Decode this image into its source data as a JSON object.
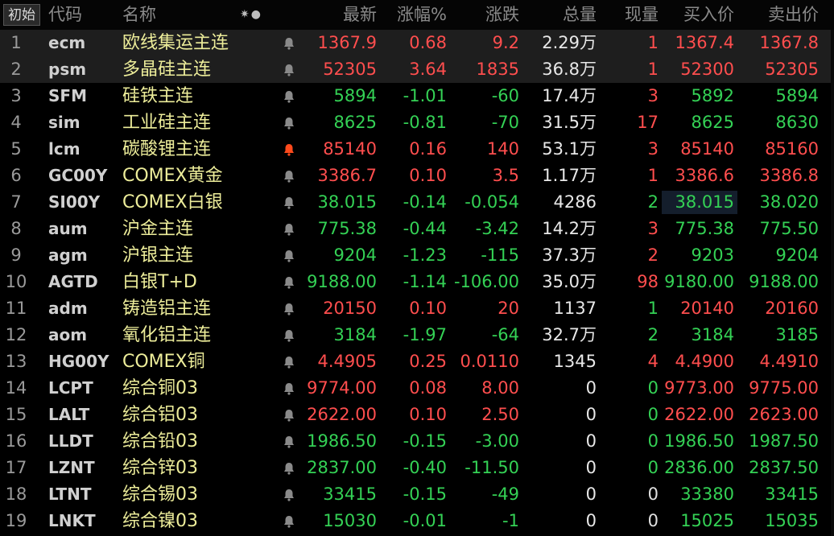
{
  "header": {
    "init_label": "初始",
    "columns": {
      "code": "代码",
      "name": "名称",
      "icons": "✷●",
      "last": "最新",
      "pct": "涨幅%",
      "chg": "涨跌",
      "vol": "总量",
      "cur": "现量",
      "bid": "买入价",
      "ask": "卖出价"
    }
  },
  "colors": {
    "up": "#ff4e4e",
    "down": "#34d155",
    "name": "#eded9a",
    "bell_active": "#ff4a1c",
    "bell_inactive": "#8a8a8a"
  },
  "rows": [
    {
      "idx": "1",
      "code": "ecm",
      "name": "欧线集运主连",
      "last": "1367.9",
      "pct": "0.68",
      "chg": "9.2",
      "vol": "2.29",
      "wan": "万",
      "cur": "1",
      "bid": "1367.4",
      "ask": "1367.8",
      "dir": "up",
      "cur_dir": "up",
      "sel": true,
      "bell_active": false
    },
    {
      "idx": "2",
      "code": "psm",
      "name": "多晶硅主连",
      "last": "52305",
      "pct": "3.64",
      "chg": "1835",
      "vol": "36.8",
      "wan": "万",
      "cur": "1",
      "bid": "52300",
      "ask": "52305",
      "dir": "up",
      "cur_dir": "up",
      "sel": true,
      "bell_active": false
    },
    {
      "idx": "3",
      "code": "SFM",
      "name": "硅铁主连",
      "last": "5894",
      "pct": "-1.01",
      "chg": "-60",
      "vol": "17.4",
      "wan": "万",
      "cur": "3",
      "bid": "5892",
      "ask": "5894",
      "dir": "down",
      "cur_dir": "up",
      "sel": false,
      "bell_active": false
    },
    {
      "idx": "4",
      "code": "sim",
      "name": "工业硅主连",
      "last": "8625",
      "pct": "-0.81",
      "chg": "-70",
      "vol": "31.5",
      "wan": "万",
      "cur": "17",
      "bid": "8625",
      "ask": "8630",
      "dir": "down",
      "cur_dir": "up",
      "sel": false,
      "bell_active": false
    },
    {
      "idx": "5",
      "code": "lcm",
      "name": "碳酸锂主连",
      "last": "85140",
      "pct": "0.16",
      "chg": "140",
      "vol": "53.1",
      "wan": "万",
      "cur": "3",
      "bid": "85140",
      "ask": "85160",
      "dir": "up",
      "cur_dir": "up",
      "sel": false,
      "bell_active": true
    },
    {
      "idx": "6",
      "code": "GC00Y",
      "name": "COMEX黄金",
      "last": "3386.7",
      "pct": "0.10",
      "chg": "3.5",
      "vol": "1.17",
      "wan": "万",
      "cur": "1",
      "bid": "3386.6",
      "ask": "3386.8",
      "dir": "up",
      "cur_dir": "up",
      "sel": false,
      "bell_active": false
    },
    {
      "idx": "7",
      "code": "SI00Y",
      "name": "COMEX白银",
      "last": "38.015",
      "pct": "-0.14",
      "chg": "-0.054",
      "vol": "4286",
      "wan": "",
      "cur": "2",
      "bid": "38.015",
      "ask": "38.020",
      "dir": "down",
      "cur_dir": "down",
      "sel": false,
      "bell_active": false,
      "hl_bid": true
    },
    {
      "idx": "8",
      "code": "aum",
      "name": "沪金主连",
      "last": "775.38",
      "pct": "-0.44",
      "chg": "-3.42",
      "vol": "14.2",
      "wan": "万",
      "cur": "3",
      "bid": "775.38",
      "ask": "775.50",
      "dir": "down",
      "cur_dir": "up",
      "sel": false,
      "bell_active": false
    },
    {
      "idx": "9",
      "code": "agm",
      "name": "沪银主连",
      "last": "9204",
      "pct": "-1.23",
      "chg": "-115",
      "vol": "37.3",
      "wan": "万",
      "cur": "2",
      "bid": "9203",
      "ask": "9204",
      "dir": "down",
      "cur_dir": "up",
      "sel": false,
      "bell_active": false
    },
    {
      "idx": "10",
      "code": "AGTD",
      "name": "白银T+D",
      "last": "9188.00",
      "pct": "-1.14",
      "chg": "-106.00",
      "vol": "35.0",
      "wan": "万",
      "cur": "98",
      "bid": "9180.00",
      "ask": "9188.00",
      "dir": "down",
      "cur_dir": "up",
      "sel": false,
      "bell_active": false
    },
    {
      "idx": "11",
      "code": "adm",
      "name": "铸造铝主连",
      "last": "20150",
      "pct": "0.10",
      "chg": "20",
      "vol": "1137",
      "wan": "",
      "cur": "1",
      "bid": "20140",
      "ask": "20160",
      "dir": "up",
      "cur_dir": "down",
      "sel": false,
      "bell_active": false
    },
    {
      "idx": "12",
      "code": "aom",
      "name": "氧化铝主连",
      "last": "3184",
      "pct": "-1.97",
      "chg": "-64",
      "vol": "32.7",
      "wan": "万",
      "cur": "2",
      "bid": "3184",
      "ask": "3185",
      "dir": "down",
      "cur_dir": "down",
      "sel": false,
      "bell_active": false
    },
    {
      "idx": "13",
      "code": "HG00Y",
      "name": "COMEX铜",
      "last": "4.4905",
      "pct": "0.25",
      "chg": "0.0110",
      "vol": "1345",
      "wan": "",
      "cur": "4",
      "bid": "4.4900",
      "ask": "4.4910",
      "dir": "up",
      "cur_dir": "up",
      "sel": false,
      "bell_active": false
    },
    {
      "idx": "14",
      "code": "LCPT",
      "name": "综合铜03",
      "last": "9774.00",
      "pct": "0.08",
      "chg": "8.00",
      "vol": "0",
      "wan": "",
      "cur": "0",
      "bid": "9773.00",
      "ask": "9775.00",
      "dir": "up",
      "cur_dir": "down",
      "sel": false,
      "bell_active": false
    },
    {
      "idx": "15",
      "code": "LALT",
      "name": "综合铝03",
      "last": "2622.00",
      "pct": "0.10",
      "chg": "2.50",
      "vol": "0",
      "wan": "",
      "cur": "0",
      "bid": "2622.00",
      "ask": "2623.00",
      "dir": "up",
      "cur_dir": "down",
      "sel": false,
      "bell_active": false
    },
    {
      "idx": "16",
      "code": "LLDT",
      "name": "综合铅03",
      "last": "1986.50",
      "pct": "-0.15",
      "chg": "-3.00",
      "vol": "0",
      "wan": "",
      "cur": "0",
      "bid": "1986.50",
      "ask": "1987.50",
      "dir": "down",
      "cur_dir": "down",
      "sel": false,
      "bell_active": false
    },
    {
      "idx": "17",
      "code": "LZNT",
      "name": "综合锌03",
      "last": "2837.00",
      "pct": "-0.40",
      "chg": "-11.50",
      "vol": "0",
      "wan": "",
      "cur": "0",
      "bid": "2836.00",
      "ask": "2837.50",
      "dir": "down",
      "cur_dir": "down",
      "sel": false,
      "bell_active": false
    },
    {
      "idx": "18",
      "code": "LTNT",
      "name": "综合锡03",
      "last": "33415",
      "pct": "-0.15",
      "chg": "-49",
      "vol": "0",
      "wan": "",
      "cur": "0",
      "bid": "33380",
      "ask": "33415",
      "dir": "down",
      "cur_dir": "flat",
      "sel": false,
      "bell_active": false
    },
    {
      "idx": "19",
      "code": "LNKT",
      "name": "综合镍03",
      "last": "15030",
      "pct": "-0.01",
      "chg": "-1",
      "vol": "0",
      "wan": "",
      "cur": "0",
      "bid": "15025",
      "ask": "15035",
      "dir": "down",
      "cur_dir": "flat",
      "sel": false,
      "bell_active": false
    }
  ]
}
